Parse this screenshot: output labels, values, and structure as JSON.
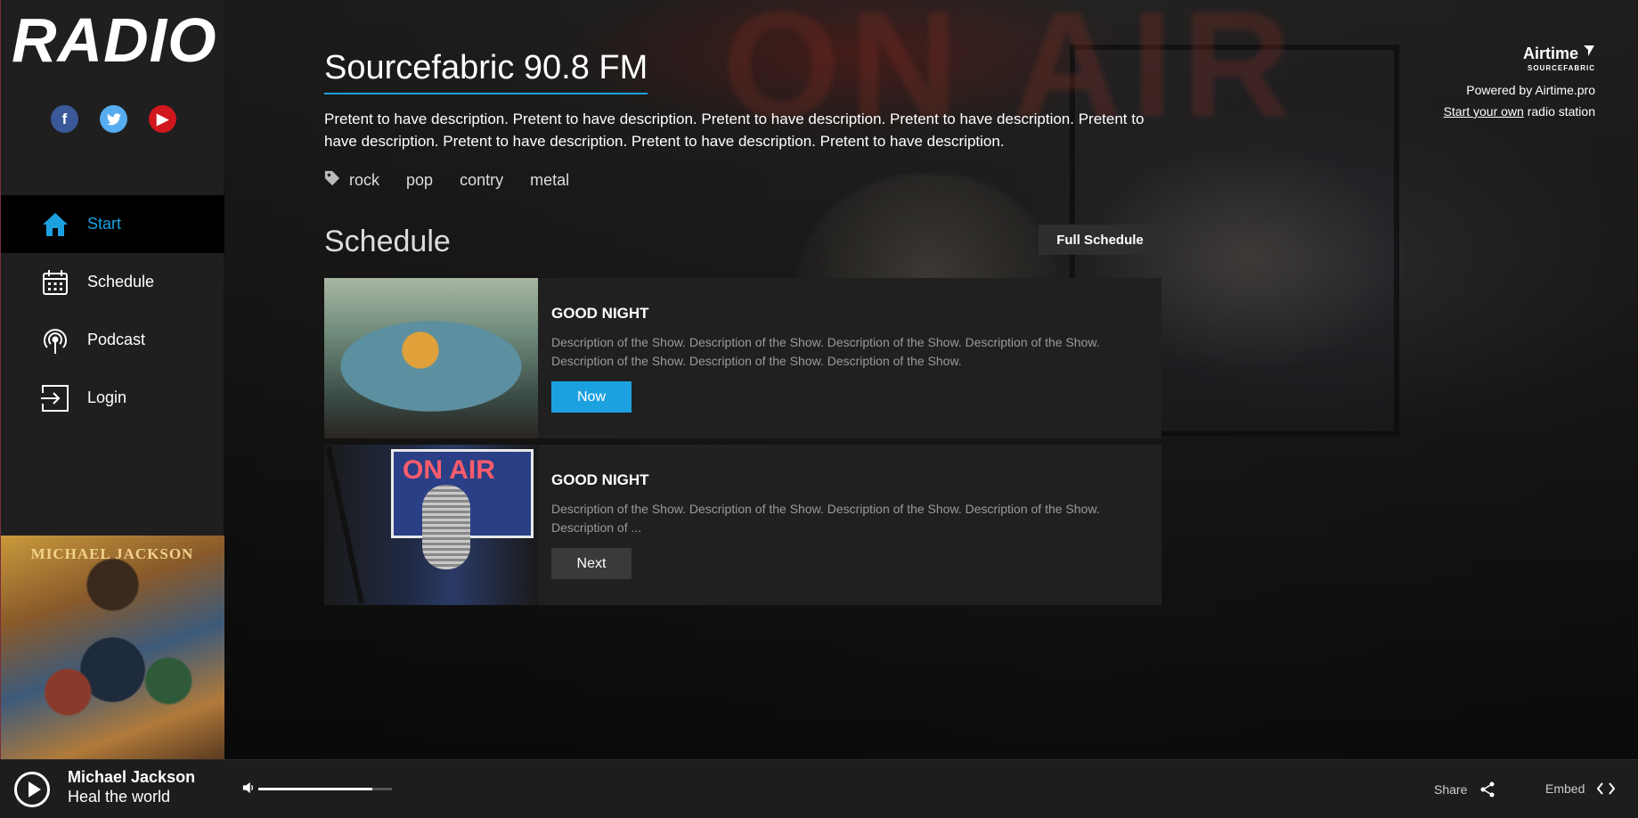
{
  "app": {
    "logo": "RADIO"
  },
  "social": [
    {
      "name": "facebook",
      "glyph": "f",
      "color": "#3b5998"
    },
    {
      "name": "twitter",
      "glyph": "t",
      "color": "#55acee"
    },
    {
      "name": "youtube",
      "glyph": "▶",
      "color": "#d0171d"
    }
  ],
  "nav": [
    {
      "label": "Start",
      "icon": "home-icon",
      "active": true
    },
    {
      "label": "Schedule",
      "icon": "calendar-icon",
      "active": false
    },
    {
      "label": "Podcast",
      "icon": "podcast-icon",
      "active": false
    },
    {
      "label": "Login",
      "icon": "login-icon",
      "active": false
    }
  ],
  "cover": {
    "text": "MICHAEL JACKSON"
  },
  "station": {
    "title": "Sourcefabric 90.8 FM",
    "description": "Pretent to have description. Pretent to have description. Pretent to have description. Pretent to have description. Pretent to have description. Pretent to have description. Pretent to have description. Pretent to have description.",
    "tags": [
      "rock",
      "pop",
      "contry",
      "metal"
    ]
  },
  "schedule": {
    "title": "Schedule",
    "full_button": "Full Schedule",
    "shows": [
      {
        "title": "GOOD NIGHT",
        "description": "Description of the Show. Description of the Show. Description of the Show. Description of the Show. Description of the Show. Description of the Show. Description of the Show.",
        "button": "Now"
      },
      {
        "title": "GOOD NIGHT",
        "description": "Description of the Show. Description of the Show. Description of the Show. Description of the Show. Description of ...",
        "button": "Next"
      }
    ]
  },
  "airtime": {
    "brand": "Airtime",
    "brand_sub": "SOURCEFABRIC",
    "powered": "Powered by Airtime.pro",
    "own_link": "Start your own",
    "own_rest": " radio station"
  },
  "player": {
    "artist": "Michael Jackson",
    "track": "Heal the world",
    "volume": 0.85,
    "share_label": "Share",
    "embed_label": "Embed"
  },
  "colors": {
    "accent": "#1ca1e0",
    "sidebar": "#1f1f1f",
    "card": "#202020"
  }
}
